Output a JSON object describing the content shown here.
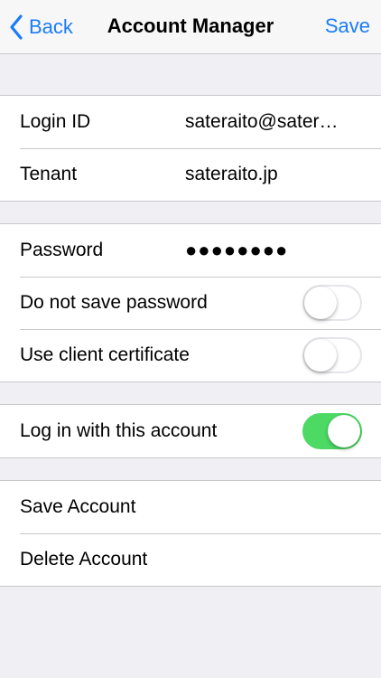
{
  "navbar": {
    "back_label": "Back",
    "title": "Account Manager",
    "save_label": "Save"
  },
  "credentials": {
    "login_id_label": "Login ID",
    "login_id_value": "sateraito@sater…",
    "tenant_label": "Tenant",
    "tenant_value": "sateraito.jp"
  },
  "password": {
    "label": "Password",
    "masked_value": "●●●●●●●●",
    "do_not_save_label": "Do not save password",
    "do_not_save_on": false,
    "client_cert_label": "Use client certificate",
    "client_cert_on": false
  },
  "login": {
    "label": "Log in with this account",
    "on": true
  },
  "actions": {
    "save_account_label": "Save Account",
    "delete_account_label": "Delete Account"
  },
  "colors": {
    "accent": "#1a7cf7",
    "toggle_on": "#4cd964",
    "background": "#efeff4"
  },
  "icons": {
    "back": "chevron-left-icon"
  }
}
